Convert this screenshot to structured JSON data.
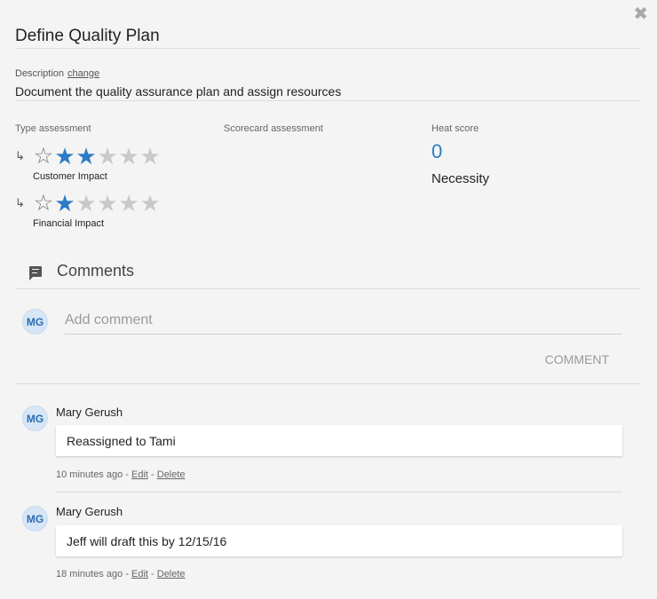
{
  "dialog": {
    "title": "Define Quality Plan",
    "close_glyph": "✖"
  },
  "description": {
    "label": "Description",
    "change_link": "change",
    "text": "Document the quality assurance plan and assign resources"
  },
  "assessment": {
    "type_label": "Type assessment",
    "scorecard_label": "Scorecard assessment",
    "heat_label": "Heat score",
    "heat_value": "0",
    "heat_category": "Necessity",
    "ratings": [
      {
        "label": "Customer Impact",
        "value": 2,
        "max": 5
      },
      {
        "label": "Financial Impact",
        "value": 1,
        "max": 5
      }
    ]
  },
  "comments": {
    "header": "Comments",
    "input_placeholder": "Add comment",
    "submit_label": "COMMENT",
    "current_user_initials": "MG",
    "items": [
      {
        "initials": "MG",
        "author": "Mary Gerush",
        "text": "Reassigned to Tami",
        "time": "10 minutes ago",
        "edit": "Edit",
        "delete": "Delete"
      },
      {
        "initials": "MG",
        "author": "Mary Gerush",
        "text": "Jeff will draft this by 12/15/16",
        "time": "18 minutes ago",
        "edit": "Edit",
        "delete": "Delete"
      }
    ]
  },
  "colors": {
    "accent": "#2b7bc6",
    "star_off": "#c9c9c9",
    "background": "#f4f4f4"
  }
}
